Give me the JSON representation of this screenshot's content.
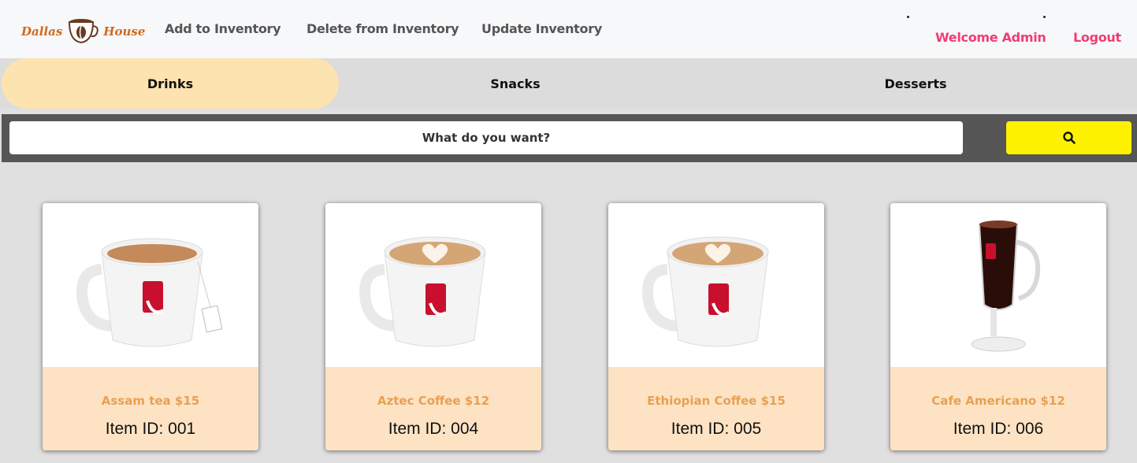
{
  "header": {
    "brand_left": "Dallas",
    "brand_right": "House",
    "nav": [
      {
        "label": "Add to Inventory"
      },
      {
        "label": "Delete from Inventory"
      },
      {
        "label": "Update Inventory"
      }
    ],
    "welcome": "Welcome Admin",
    "logout": "Logout"
  },
  "tabs": [
    {
      "label": "Drinks",
      "active": true
    },
    {
      "label": "Snacks",
      "active": false
    },
    {
      "label": "Desserts",
      "active": false
    }
  ],
  "search": {
    "placeholder": "What do you want?"
  },
  "items": [
    {
      "title": "Assam tea $15",
      "id_text": "Item ID: 001",
      "image": "mug-tea"
    },
    {
      "title": "Aztec Coffee $12",
      "id_text": "Item ID: 004",
      "image": "mug-latte"
    },
    {
      "title": "Ethiopian Coffee $15",
      "id_text": "Item ID: 005",
      "image": "mug-latte"
    },
    {
      "title": "Cafe Americano $12",
      "id_text": "Item ID: 006",
      "image": "glass-americano"
    }
  ],
  "colors": {
    "accent_pink": "#ef3d72",
    "tab_active": "#fde3b0",
    "search_button": "#fff200",
    "card_footer": "#fde3c4",
    "card_title": "#e8a053",
    "brand": "#d2691e"
  }
}
